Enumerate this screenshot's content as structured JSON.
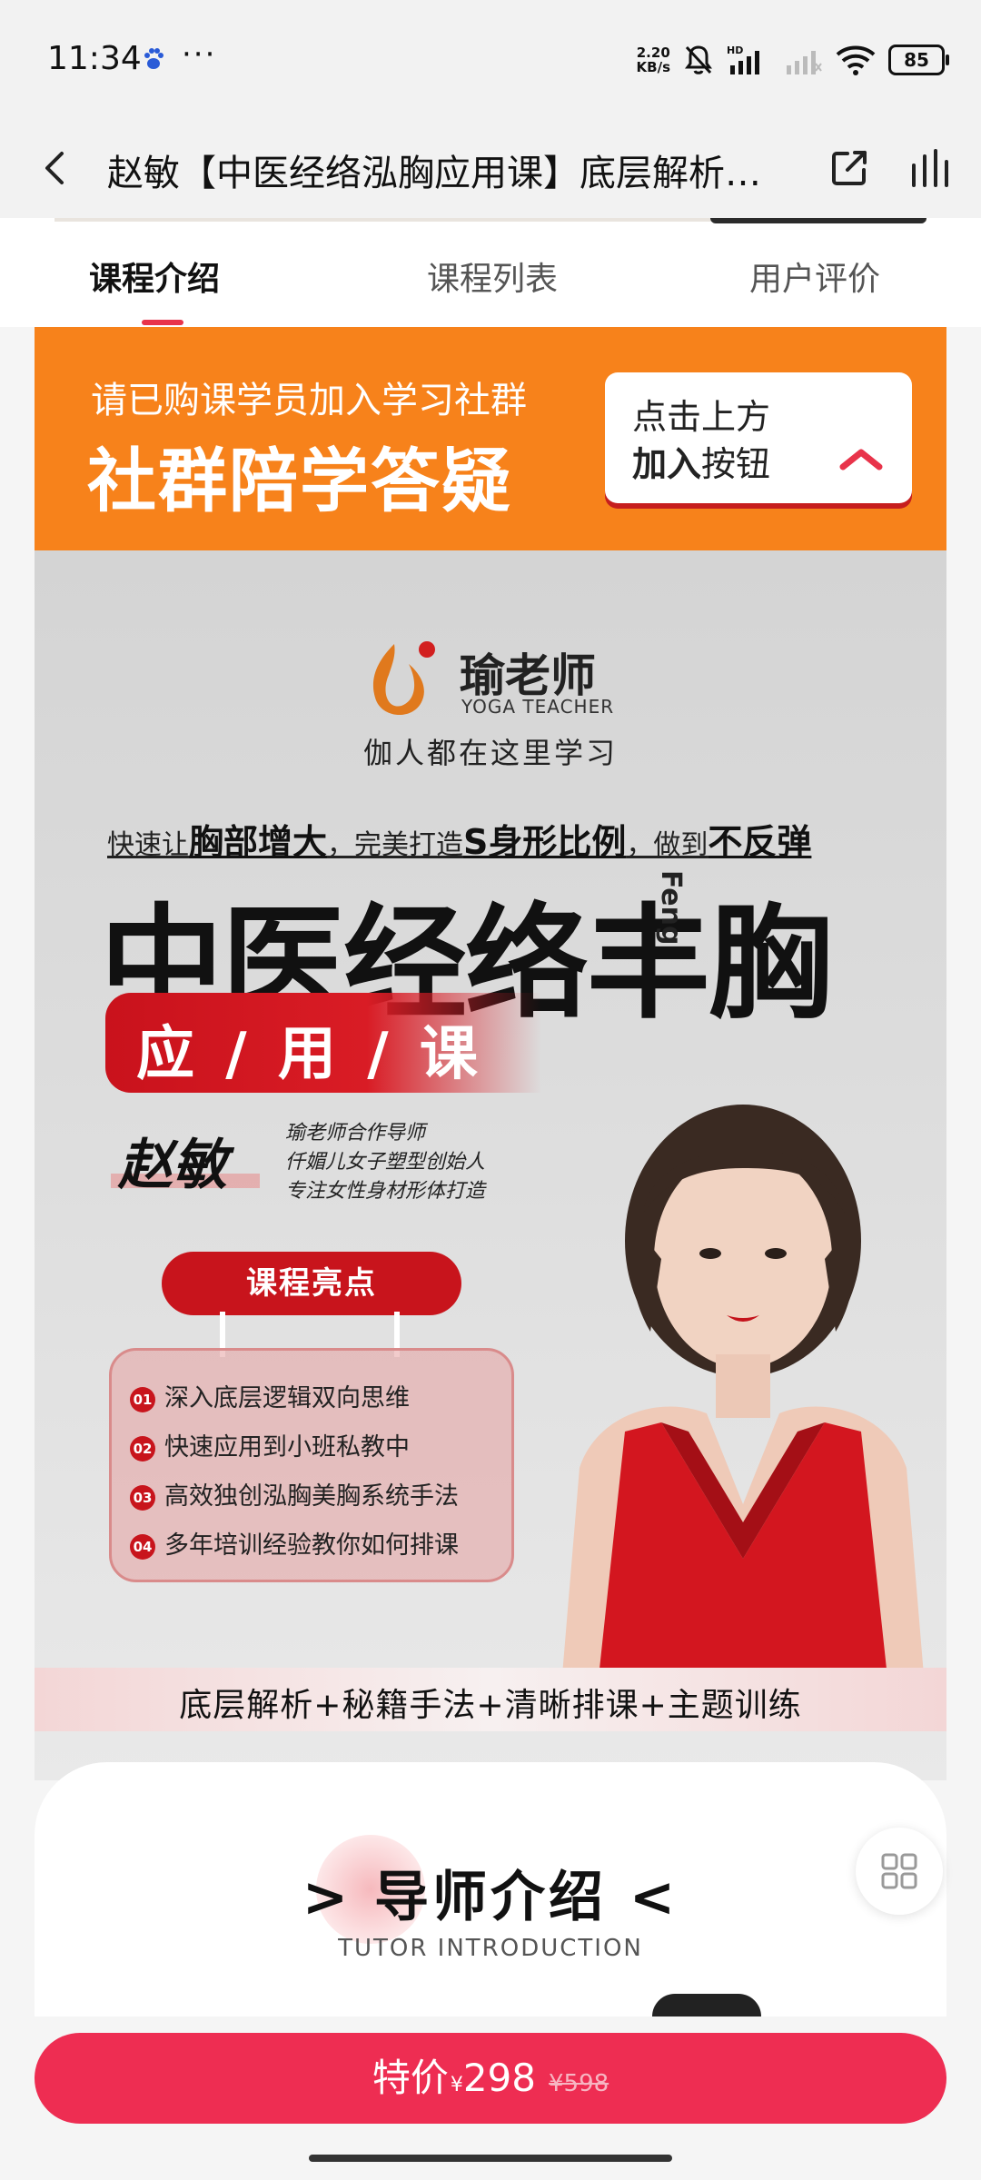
{
  "status_bar": {
    "time": "11:34",
    "more": "···",
    "net_speed_value": "2.20",
    "net_speed_unit": "KB/s",
    "hd_label": "HD",
    "battery": "85"
  },
  "nav": {
    "title": "赵敏【中医经络泓胸应用课】底层解析…"
  },
  "tabs": [
    {
      "label": "课程介绍",
      "active": true
    },
    {
      "label": "课程列表",
      "active": false
    },
    {
      "label": "用户评价",
      "active": false
    }
  ],
  "banner": {
    "small": "请已购课学员加入学习社群",
    "big": "社群陪学答疑",
    "card_line1": "点击上方",
    "card_line2_bold": "加入",
    "card_line2_rest": "按钮"
  },
  "poster": {
    "logo_cn": "瑜老师",
    "logo_en": "YOGA TEACHER",
    "slogan": "伽人都在这里学习",
    "tagline": {
      "p1": "快速让",
      "b1": "胸部增大",
      "p2": "，完美打造",
      "b2": "S身形比例",
      "p3": "，做到",
      "b3": "不反弹"
    },
    "headline": "中医经络丰胸",
    "feng": "Feng",
    "course": "应 / 用 / 课",
    "author": "赵敏",
    "author_lines": [
      "瑜老师合作导师",
      "仟媚儿女子塑型创始人",
      "专注女性身材形体打造"
    ],
    "highlights_title": "课程亮点",
    "highlights": [
      {
        "num": "01",
        "text": "深入底层逻辑双向思维"
      },
      {
        "num": "02",
        "text": "快速应用到小班私教中"
      },
      {
        "num": "03",
        "text": "高效独创泓胸美胸系统手法"
      },
      {
        "num": "04",
        "text": "多年培训经验教你如何排课"
      }
    ],
    "bottom_strip": "底层解析+秘籍手法+清晰排课+主题训练"
  },
  "tutor": {
    "title": "> 导师介绍 <",
    "subtitle": "TUTOR INTRODUCTION"
  },
  "purchase": {
    "label": "特价",
    "currency": "¥",
    "price": "298",
    "original": "¥598"
  },
  "icons": [
    "back-icon",
    "share-icon",
    "stats-icon",
    "mute-icon",
    "signal-icon",
    "wifi-icon",
    "battery-icon",
    "chevron-up-icon",
    "grid-menu-icon"
  ],
  "colors": {
    "accent": "#ee2d52",
    "banner": "#f7821b",
    "poster_red": "#c8141c"
  }
}
